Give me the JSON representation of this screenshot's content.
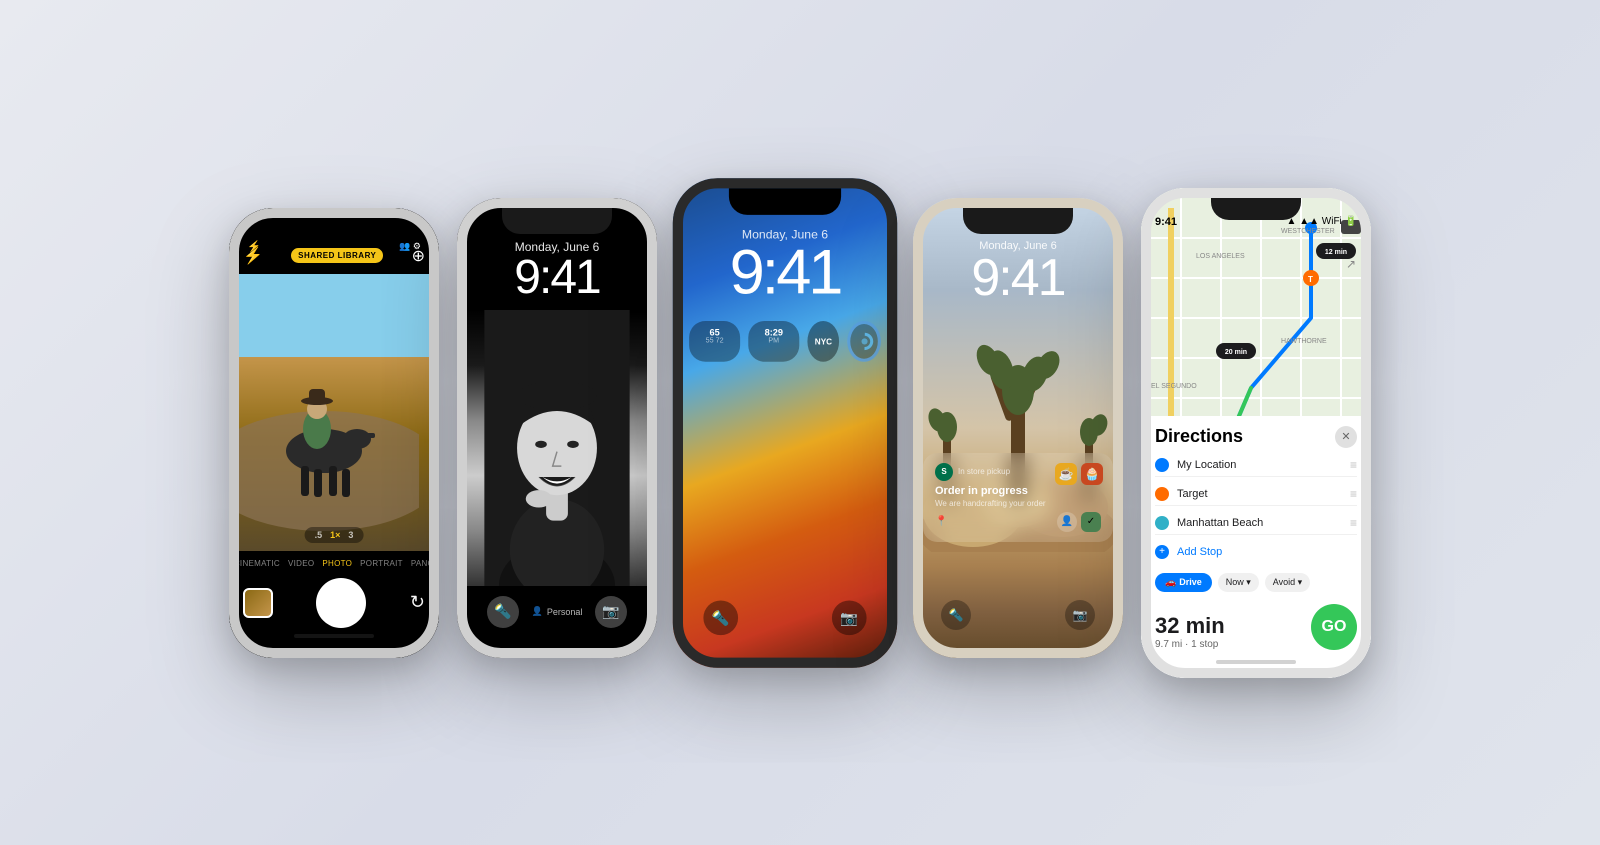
{
  "phones": {
    "phone1": {
      "badge": "SHARED LIBRARY",
      "modes": [
        "CINEMATIC",
        "VIDEO",
        "PHOTO",
        "PORTRAIT",
        "PANO"
      ],
      "active_mode": "PHOTO",
      "zoom_levels": [
        ".5",
        "1×",
        "3"
      ],
      "active_zoom": "1×"
    },
    "phone2": {
      "date": "Monday, June 6",
      "time": "9:41",
      "profile": "Personal",
      "torch_icon": "🔦",
      "camera_icon": "📷"
    },
    "phone3": {
      "date": "Monday, June 6",
      "time": "9:41",
      "widget1_temp": "65",
      "widget1_range": "55 72",
      "widget2_time": "8:29",
      "widget2_label": "PM",
      "widget3_label": "NYC",
      "torch_icon": "🔦",
      "camera_icon": "📷"
    },
    "phone4": {
      "date": "Monday, June 6",
      "time": "9:41",
      "notif_app": "In store pickup",
      "notif_title": "Order in progress",
      "notif_sub": "We are handcrafting your order",
      "torch_icon": "🔦",
      "camera_icon": "📷"
    },
    "phone5": {
      "status_time": "9:41",
      "eta_label": "12 min",
      "directions_title": "Directions",
      "route1": "My Location",
      "route2": "Target",
      "route3": "Manhattan Beach",
      "add_stop": "Add Stop",
      "transport": "Drive",
      "time_option": "Now",
      "avoid_option": "Avoid",
      "trip_time": "32 min",
      "trip_detail": "9.7 mi · 1 stop",
      "go_label": "GO",
      "close_icon": "✕",
      "location_label": "Location",
      "location_value": "Manhattan Beach"
    }
  }
}
